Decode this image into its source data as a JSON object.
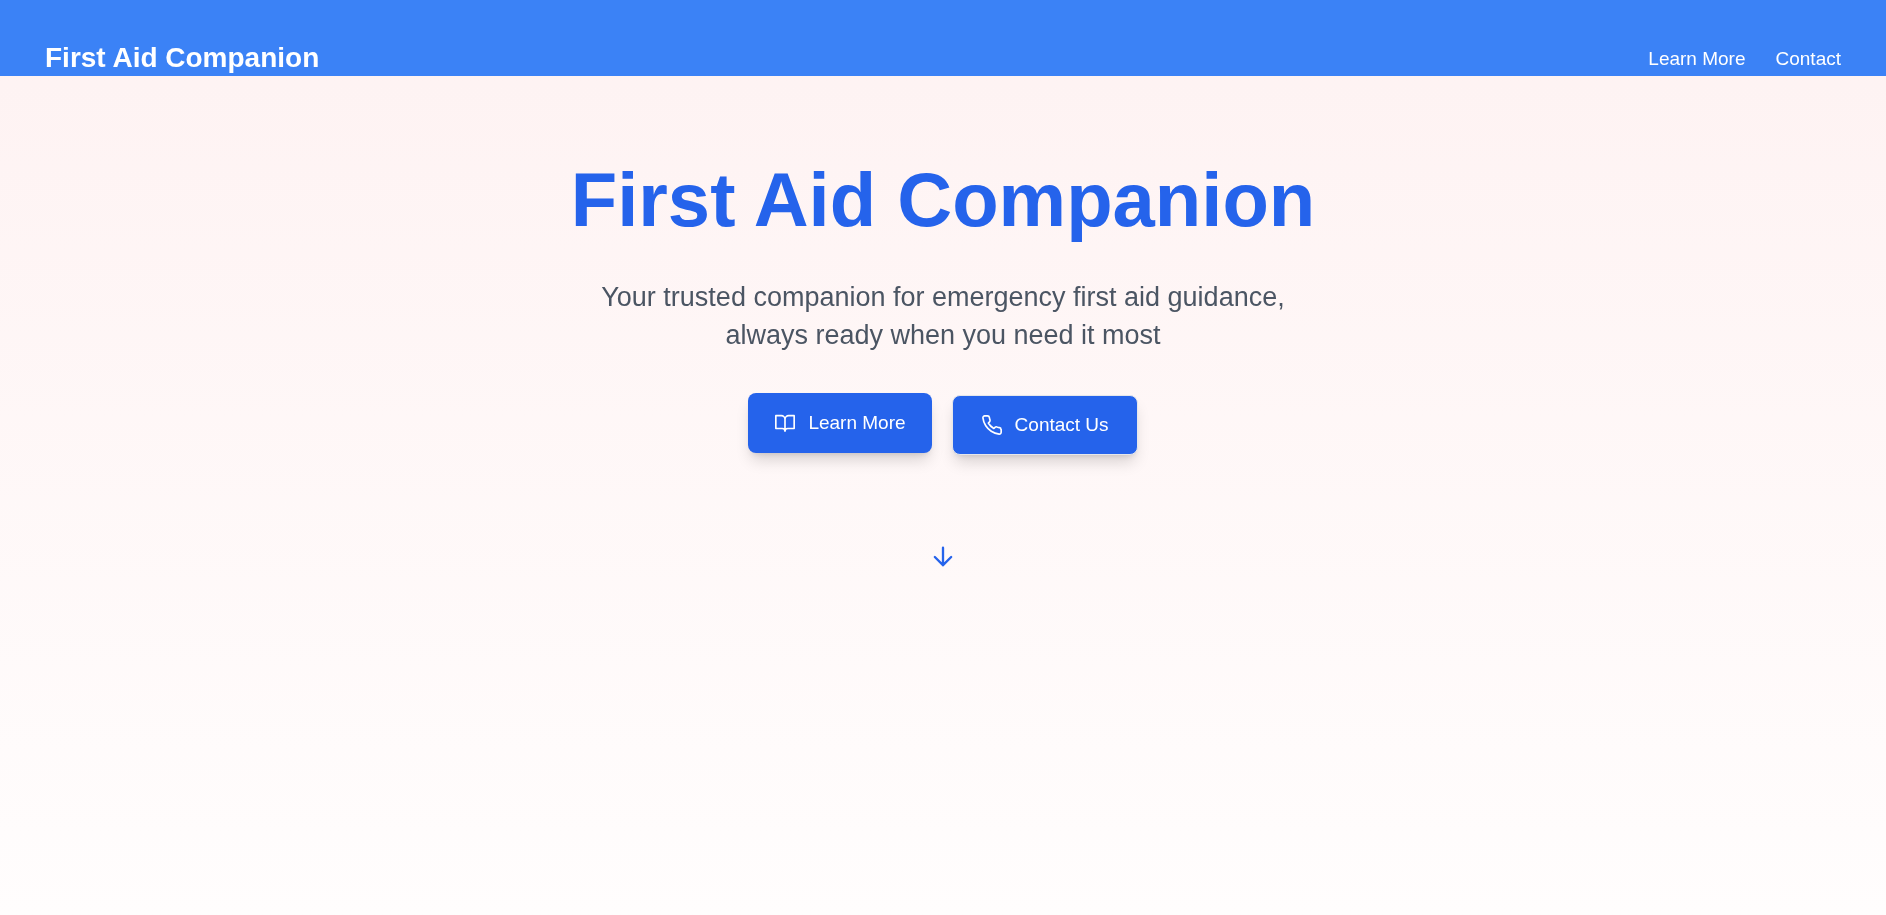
{
  "header": {
    "title": "First Aid Companion",
    "nav": [
      {
        "label": "Learn More"
      },
      {
        "label": "Contact"
      }
    ]
  },
  "hero": {
    "title": "First Aid Companion",
    "subtitle": "Your trusted companion for emergency first aid guidance, always ready when you need it most",
    "buttons": [
      {
        "label": "Learn More"
      },
      {
        "label": "Contact Us"
      }
    ]
  }
}
